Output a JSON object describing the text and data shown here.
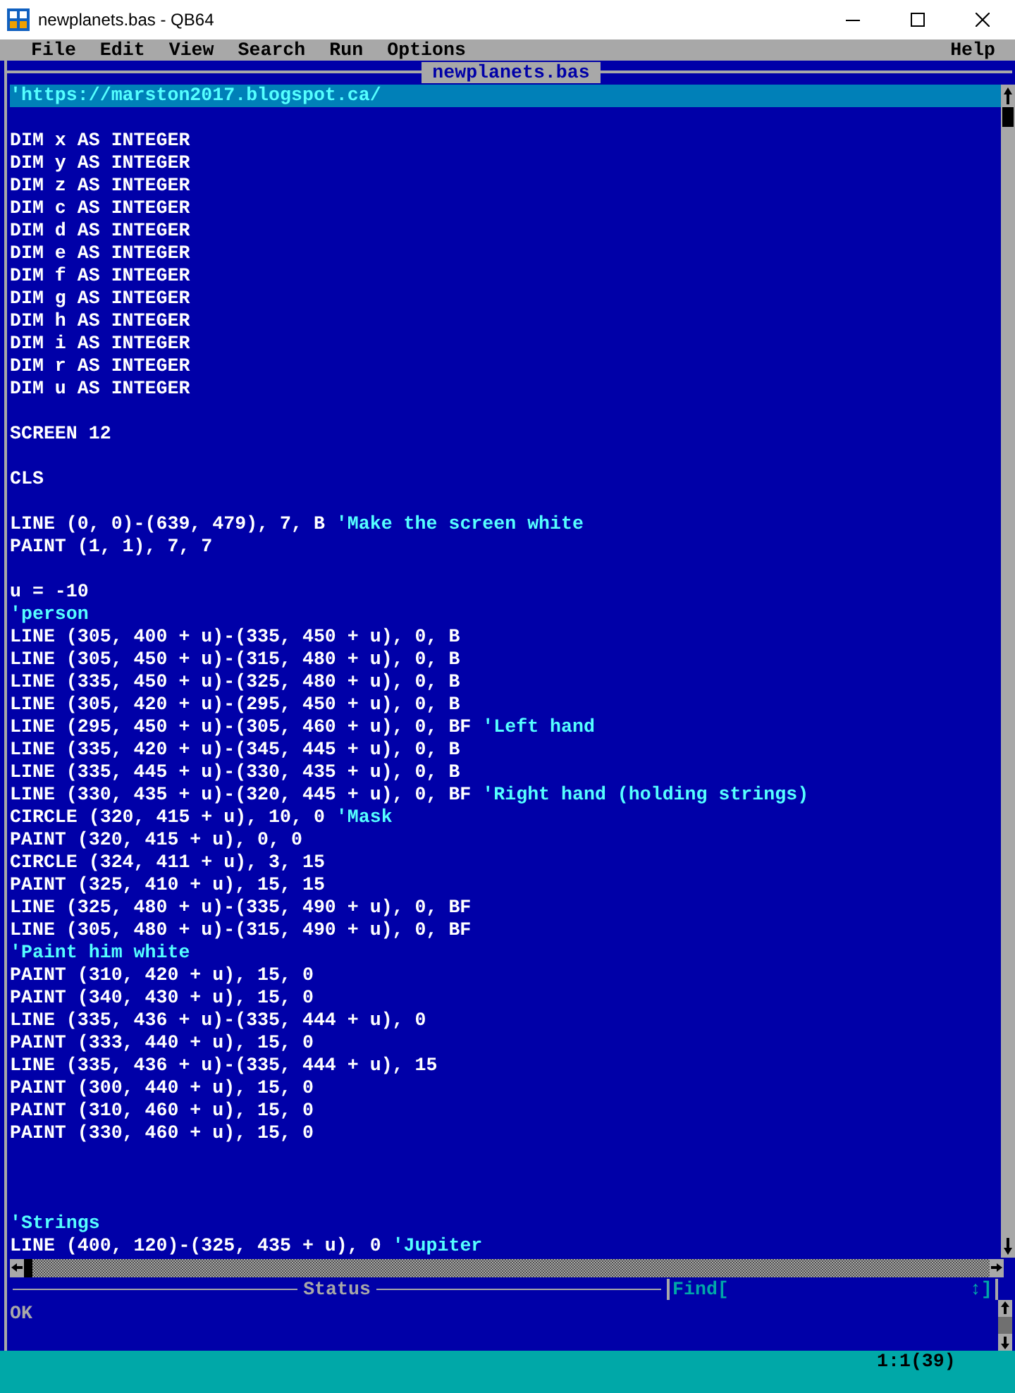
{
  "window": {
    "title": "newplanets.bas - QB64"
  },
  "menu": {
    "items": [
      "File",
      "Edit",
      "View",
      "Search",
      "Run",
      "Options"
    ],
    "help": "Help"
  },
  "editor": {
    "tab_title": "newplanets.bas",
    "lines": [
      {
        "kind": "code",
        "comment": "'https://marston2017.blogspot.ca/",
        "selected": true
      },
      {
        "kind": "blank",
        "selected": false
      },
      {
        "kind": "code",
        "code": "DIM x AS INTEGER",
        "selected": false
      },
      {
        "kind": "code",
        "code": "DIM y AS INTEGER",
        "selected": false
      },
      {
        "kind": "code",
        "code": "DIM z AS INTEGER",
        "selected": false
      },
      {
        "kind": "code",
        "code": "DIM c AS INTEGER",
        "selected": false
      },
      {
        "kind": "code",
        "code": "DIM d AS INTEGER",
        "selected": false
      },
      {
        "kind": "code",
        "code": "DIM e AS INTEGER",
        "selected": false
      },
      {
        "kind": "code",
        "code": "DIM f AS INTEGER",
        "selected": false
      },
      {
        "kind": "code",
        "code": "DIM g AS INTEGER",
        "selected": false
      },
      {
        "kind": "code",
        "code": "DIM h AS INTEGER",
        "selected": false
      },
      {
        "kind": "code",
        "code": "DIM i AS INTEGER",
        "selected": false
      },
      {
        "kind": "code",
        "code": "DIM r AS INTEGER",
        "selected": false
      },
      {
        "kind": "code",
        "code": "DIM u AS INTEGER",
        "selected": false
      },
      {
        "kind": "blank",
        "selected": false
      },
      {
        "kind": "code",
        "code": "SCREEN 12",
        "selected": false
      },
      {
        "kind": "blank",
        "selected": false
      },
      {
        "kind": "code",
        "code": "CLS",
        "selected": false
      },
      {
        "kind": "blank",
        "selected": false
      },
      {
        "kind": "code",
        "code": "LINE (0, 0)-(639, 479), 7, B",
        "comment": "'Make the screen white",
        "selected": false
      },
      {
        "kind": "code",
        "code": "PAINT (1, 1), 7, 7",
        "selected": false
      },
      {
        "kind": "blank",
        "selected": false
      },
      {
        "kind": "code",
        "code": "u = -10",
        "selected": false
      },
      {
        "kind": "code",
        "comment": "'person",
        "selected": false
      },
      {
        "kind": "code",
        "code": "LINE (305, 400 + u)-(335, 450 + u), 0, B",
        "selected": false
      },
      {
        "kind": "code",
        "code": "LINE (305, 450 + u)-(315, 480 + u), 0, B",
        "selected": false
      },
      {
        "kind": "code",
        "code": "LINE (335, 450 + u)-(325, 480 + u), 0, B",
        "selected": false
      },
      {
        "kind": "code",
        "code": "LINE (305, 420 + u)-(295, 450 + u), 0, B",
        "selected": false
      },
      {
        "kind": "code",
        "code": "LINE (295, 450 + u)-(305, 460 + u), 0, BF",
        "comment": "'Left hand",
        "selected": false
      },
      {
        "kind": "code",
        "code": "LINE (335, 420 + u)-(345, 445 + u), 0, B",
        "selected": false
      },
      {
        "kind": "code",
        "code": "LINE (335, 445 + u)-(330, 435 + u), 0, B",
        "selected": false
      },
      {
        "kind": "code",
        "code": "LINE (330, 435 + u)-(320, 445 + u), 0, BF",
        "comment": "'Right hand (holding strings)",
        "selected": false
      },
      {
        "kind": "code",
        "code": "CIRCLE (320, 415 + u), 10, 0",
        "comment": "'Mask",
        "selected": false
      },
      {
        "kind": "code",
        "code": "PAINT (320, 415 + u), 0, 0",
        "selected": false
      },
      {
        "kind": "code",
        "code": "CIRCLE (324, 411 + u), 3, 15",
        "selected": false
      },
      {
        "kind": "code",
        "code": "PAINT (325, 410 + u), 15, 15",
        "selected": false
      },
      {
        "kind": "code",
        "code": "LINE (325, 480 + u)-(335, 490 + u), 0, BF",
        "selected": false
      },
      {
        "kind": "code",
        "code": "LINE (305, 480 + u)-(315, 490 + u), 0, BF",
        "selected": false
      },
      {
        "kind": "code",
        "comment": "'Paint him white",
        "selected": false
      },
      {
        "kind": "code",
        "code": "PAINT (310, 420 + u), 15, 0",
        "selected": false
      },
      {
        "kind": "code",
        "code": "PAINT (340, 430 + u), 15, 0",
        "selected": false
      },
      {
        "kind": "code",
        "code": "LINE (335, 436 + u)-(335, 444 + u), 0",
        "selected": false
      },
      {
        "kind": "code",
        "code": "PAINT (333, 440 + u), 15, 0",
        "selected": false
      },
      {
        "kind": "code",
        "code": "LINE (335, 436 + u)-(335, 444 + u), 15",
        "selected": false
      },
      {
        "kind": "code",
        "code": "PAINT (300, 440 + u), 15, 0",
        "selected": false
      },
      {
        "kind": "code",
        "code": "PAINT (310, 460 + u), 15, 0",
        "selected": false
      },
      {
        "kind": "code",
        "code": "PAINT (330, 460 + u), 15, 0",
        "selected": false
      },
      {
        "kind": "blank",
        "selected": false
      },
      {
        "kind": "blank",
        "selected": false
      },
      {
        "kind": "blank",
        "selected": false
      },
      {
        "kind": "code",
        "comment": "'Strings",
        "selected": false
      },
      {
        "kind": "code",
        "code": "LINE (400, 120)-(325, 435 + u), 0",
        "comment": "'Jupiter",
        "selected": false
      }
    ]
  },
  "status_panel": {
    "title": "Status",
    "find_label": "Find[",
    "find_end": "↕]",
    "message": "OK"
  },
  "status_bar": {
    "position": "1:1(39)"
  }
}
